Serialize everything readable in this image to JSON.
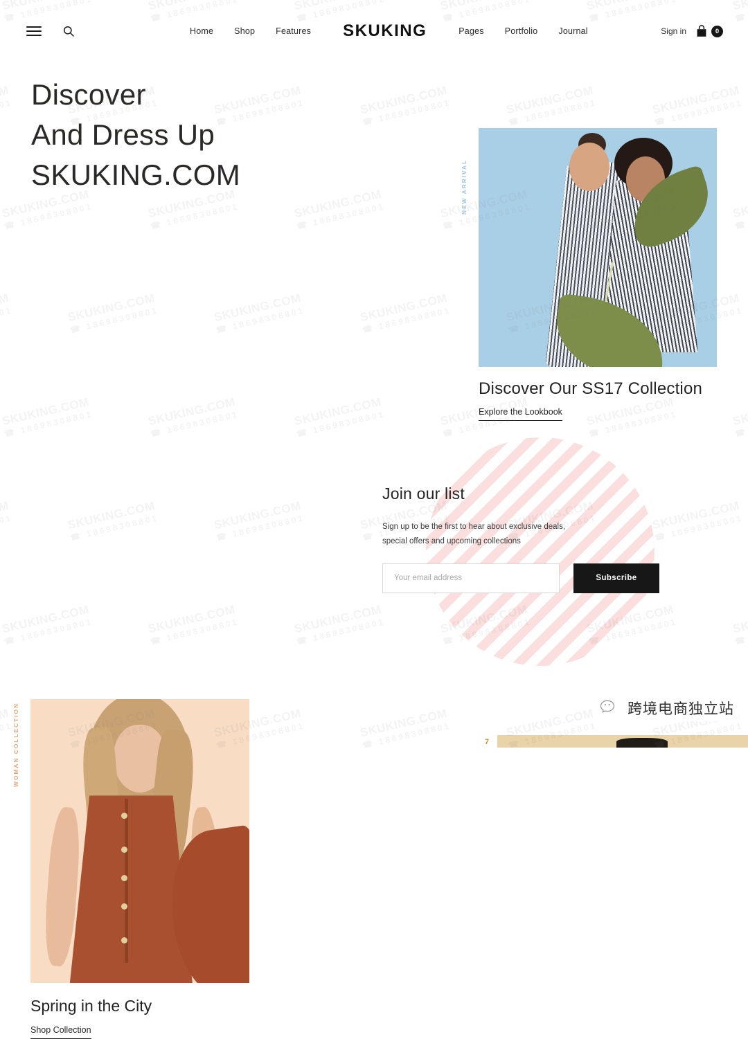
{
  "site": {
    "brand": "SKUKING",
    "watermark": {
      "line1": "SKUKING.COM",
      "line2": "☎ 18698308801"
    }
  },
  "header": {
    "menu_icon": "hamburger-icon",
    "search_icon": "search-icon",
    "nav_left": [
      {
        "label": "Home"
      },
      {
        "label": "Shop"
      },
      {
        "label": "Features"
      }
    ],
    "nav_right": [
      {
        "label": "Pages"
      },
      {
        "label": "Portfolio"
      },
      {
        "label": "Journal"
      }
    ],
    "sign_in_label": "Sign in",
    "cart_icon": "shopping-bag-icon",
    "cart_count": "0"
  },
  "hero": {
    "title_line1": "Discover",
    "title_line2": "And Dress Up",
    "title_line3": "SKUKING.COM",
    "badge_label": "NEW ARRIVAL",
    "badge_color": "#9fc7e8",
    "photo_alt": "two models wearing striped dresses on light blue background",
    "photo_bg": "#a9cfe7",
    "caption": "Discover Our SS17 Collection",
    "link_label": "Explore the Lookbook"
  },
  "collection": {
    "badge_label": "WOMAN COLLECTION",
    "badge_color": "#e8a97e",
    "photo_alt": "blonde model in rust sleeveless dress on peach background",
    "photo_bg": "#f8dcc4",
    "caption": "Spring in the City",
    "link_label": "Shop Collection"
  },
  "newsletter": {
    "title": "Join our list",
    "description": "Sign up to be the first to hear about exclusive deals, special offers and upcoming collections",
    "email_placeholder": "Your email address",
    "email_value": "",
    "submit_label": "Subscribe",
    "decoration_color": "#fbdede"
  },
  "footer_badge": {
    "icon": "wechat-icon",
    "label": "跨境电商独立站",
    "strip_mark": "7"
  }
}
